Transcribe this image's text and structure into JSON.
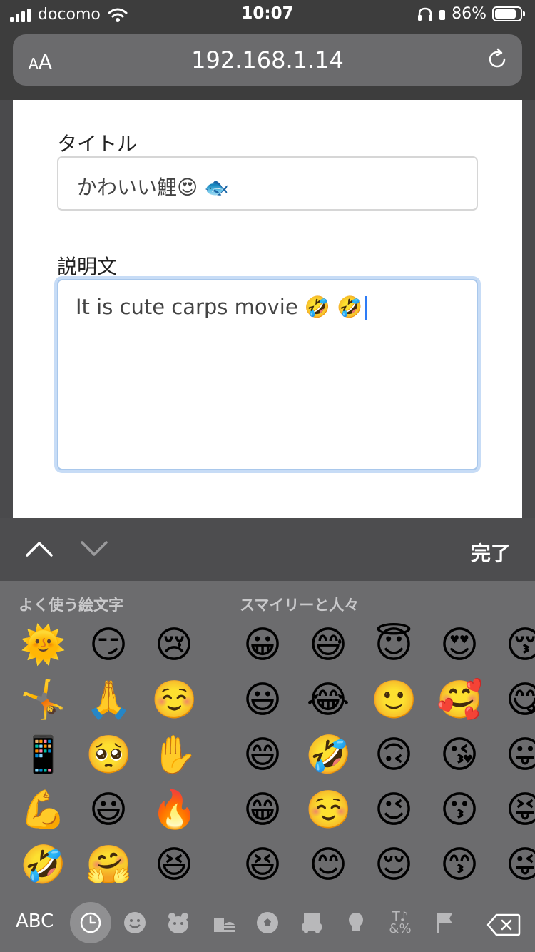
{
  "status": {
    "carrier": "docomo",
    "time": "10:07",
    "battery": "86%",
    "battery_level": 0.86
  },
  "browser": {
    "aa_label": "AA",
    "url": "192.168.1.14"
  },
  "form": {
    "title_label": "タイトル",
    "title_value": "かわいい鯉😍 🐟",
    "desc_label": "説明文",
    "desc_value": "It is cute carps movie 🤣 🤣"
  },
  "keyboard": {
    "done_label": "完了",
    "recent_label": "よく使う絵文字",
    "smileys_label": "スマイリーと人々",
    "abc_label": "ABC",
    "emoji_rows": [
      [
        "🌞",
        "😏",
        "😢",
        "😀",
        "😅",
        "😇",
        "😍",
        "😚"
      ],
      [
        "🤸",
        "🙏",
        "☺️",
        "😃",
        "😂",
        "🙂",
        "🥰",
        "😋"
      ],
      [
        "📱",
        "🥺",
        "✋",
        "😄",
        "🤣",
        "🙃",
        "😘",
        "😛"
      ],
      [
        "💪",
        "😃",
        "🔥",
        "😁",
        "☺️",
        "😉",
        "😗",
        "😝"
      ],
      [
        "🤣",
        "🤗",
        "😆",
        "😆",
        "😊",
        "😌",
        "😙",
        "😜"
      ]
    ],
    "categories": [
      "clock-icon",
      "smiley-icon",
      "bear-icon",
      "food-icon",
      "ball-icon",
      "car-icon",
      "bulb-icon",
      "symbols-icon",
      "flag-icon"
    ]
  }
}
